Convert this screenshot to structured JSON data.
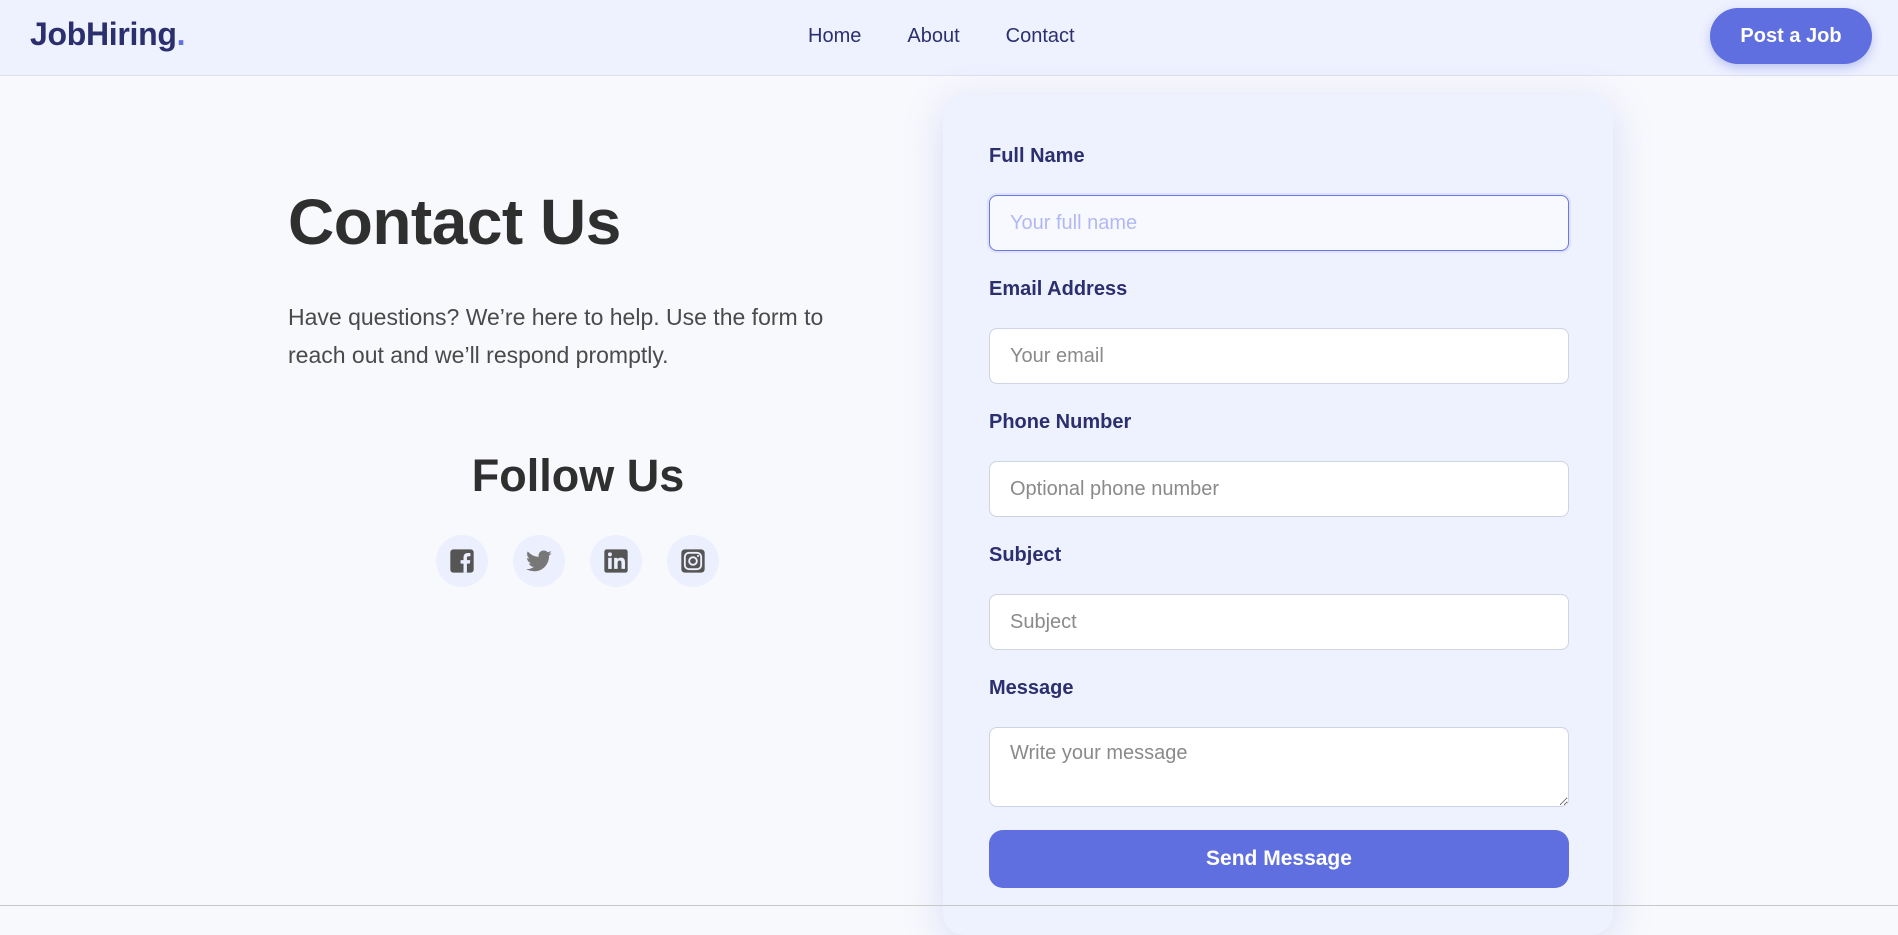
{
  "header": {
    "logo_text": "JobHiring",
    "logo_dot": ".",
    "nav": [
      "Home",
      "About",
      "Contact"
    ],
    "post_button": "Post a Job"
  },
  "intro": {
    "title": "Contact Us",
    "text": "Have questions? We’re here to help. Use the form to reach out and we’ll respond promptly."
  },
  "follow": {
    "title": "Follow Us",
    "icons": [
      "facebook-icon",
      "twitter-icon",
      "linkedin-icon",
      "instagram-icon"
    ]
  },
  "form": {
    "full_name_label": "Full Name",
    "full_name_placeholder": "Your full name",
    "email_label": "Email Address",
    "email_placeholder": "Your email",
    "phone_label": "Phone Number",
    "phone_placeholder": "Optional phone number",
    "subject_label": "Subject",
    "subject_placeholder": "Subject",
    "message_label": "Message",
    "message_placeholder": "Write your message",
    "submit_label": "Send Message"
  },
  "colors": {
    "accent": "#5f6fe0",
    "brand_text": "#2b2f6e",
    "header_bg": "#eef1fe",
    "page_bg": "#f8f9fd"
  }
}
